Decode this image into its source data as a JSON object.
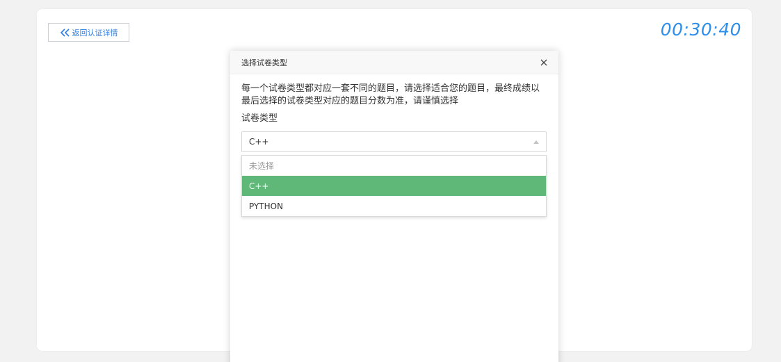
{
  "header": {
    "back_label": "返回认证详情",
    "timer": "00:30:40"
  },
  "modal": {
    "title": "选择试卷类型",
    "description": "每一个试卷类型都对应一套不同的题目，请选择适合您的题目，最终成绩以最后选择的试卷类型对应的题目分数为准，请谨慎选择",
    "field_label": "试卷类型",
    "select_value": "C++",
    "options": [
      {
        "label": "未选择"
      },
      {
        "label": "C++"
      },
      {
        "label": "PYTHON"
      }
    ]
  },
  "colors": {
    "accent": "#2f8fe8",
    "selected_option": "#5fb878"
  },
  "icons": {
    "back": "double-chevron-left-icon",
    "close": "close-icon",
    "caret": "caret-up-icon"
  }
}
